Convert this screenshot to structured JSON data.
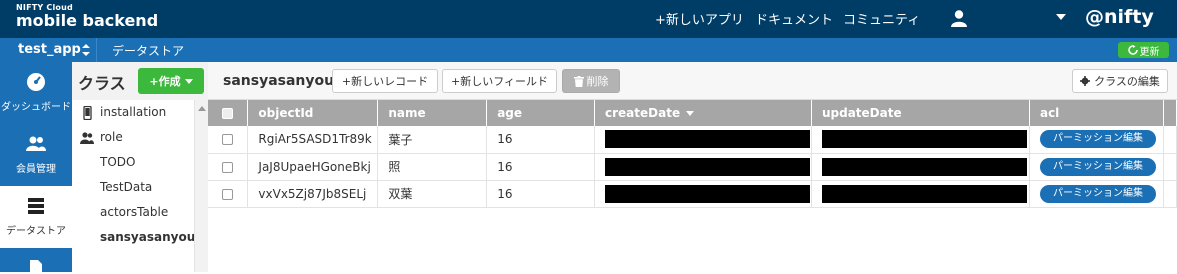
{
  "header": {
    "logo_small": "NIFTY Cloud",
    "logo_main": "mobile backend",
    "nav": [
      "+新しいアプリ",
      "ドキュメント",
      "コミュニティ"
    ],
    "brand": "@nifty"
  },
  "appbar": {
    "app_name": "test_app",
    "section": "データストア",
    "refresh_label": "更新"
  },
  "leftnav": {
    "items": [
      {
        "label": "ダッシュボード",
        "icon": "dashboard-icon"
      },
      {
        "label": "会員管理",
        "icon": "users-icon"
      },
      {
        "label": "データストア",
        "icon": "database-icon"
      }
    ]
  },
  "classes": {
    "title": "クラス",
    "create_label": "+作成",
    "items": [
      {
        "label": "installation",
        "icon": "mobile-icon"
      },
      {
        "label": "role",
        "icon": "users-icon"
      },
      {
        "label": "TODO"
      },
      {
        "label": "TestData"
      },
      {
        "label": "actorsTable"
      },
      {
        "label": "sansyasanyou"
      }
    ]
  },
  "main": {
    "class_name": "sansyasanyou",
    "buttons": {
      "new_record": "+新しいレコード",
      "new_field": "+新しいフィールド",
      "delete": "削除",
      "edit_class": "クラスの編集"
    }
  },
  "table": {
    "columns": [
      "objectId",
      "name",
      "age",
      "createDate",
      "updateDate",
      "acl"
    ],
    "rows": [
      {
        "objectId": "RgiAr5SASD1Tr89k",
        "name": "葉子",
        "age": "16",
        "acl": "パーミッション編集"
      },
      {
        "objectId": "JaJ8UpaeHGoneBkj",
        "name": "照",
        "age": "16",
        "acl": "パーミッション編集"
      },
      {
        "objectId": "vxVx5Zj87Jb8SELj",
        "name": "双葉",
        "age": "16",
        "acl": "パーミッション編集"
      }
    ]
  },
  "colors": {
    "header_bg": "#003d66",
    "accent_blue": "#1a6fb5",
    "create_green": "#3cb83c",
    "table_header": "#a6a6a6"
  }
}
